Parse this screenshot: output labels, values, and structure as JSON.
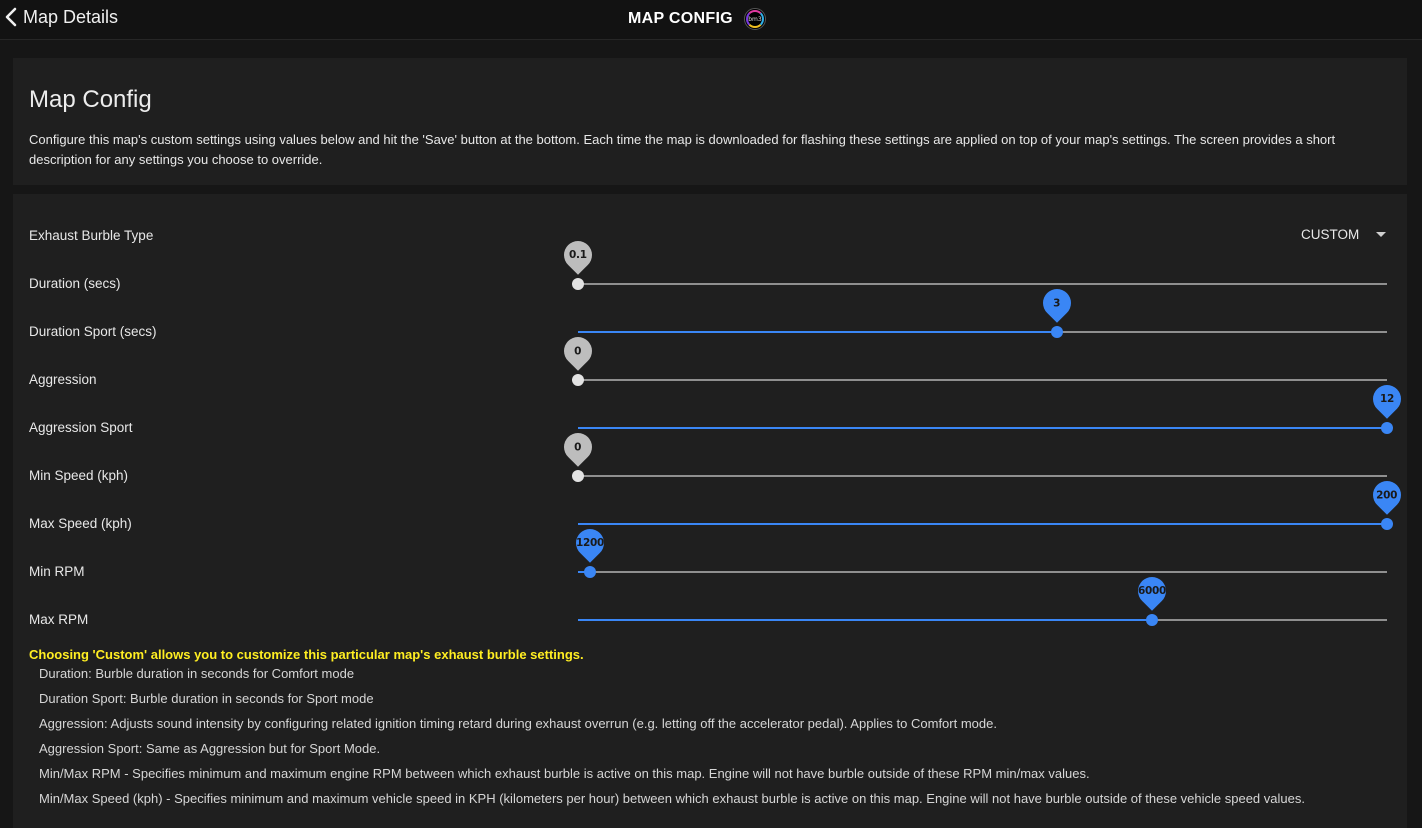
{
  "topbar": {
    "back_label": "Map Details",
    "title": "MAP CONFIG",
    "logo_text": "bm3"
  },
  "intro": {
    "heading": "Map Config",
    "description": "Configure this map's custom settings using values below and hit the 'Save' button at the bottom. Each time the map is downloaded for flashing these settings are applied on top of your map's settings. The screen provides a short description for any settings you choose to override."
  },
  "settings": {
    "burble_type_label": "Exhaust Burble Type",
    "burble_type_value": "CUSTOM",
    "sliders": [
      {
        "label": "Duration (secs)",
        "value": "0.1",
        "fraction": 0.0,
        "active": false
      },
      {
        "label": "Duration Sport (secs)",
        "value": "3",
        "fraction": 0.592,
        "active": true
      },
      {
        "label": "Aggression",
        "value": "0",
        "fraction": 0.0,
        "active": false
      },
      {
        "label": "Aggression Sport",
        "value": "12",
        "fraction": 1.0,
        "active": true
      },
      {
        "label": "Min Speed (kph)",
        "value": "0",
        "fraction": 0.0,
        "active": false
      },
      {
        "label": "Max Speed (kph)",
        "value": "200",
        "fraction": 1.0,
        "active": true
      },
      {
        "label": "Min RPM",
        "value": "1200",
        "fraction": 0.015,
        "active": true
      },
      {
        "label": "Max RPM",
        "value": "6000",
        "fraction": 0.709,
        "active": true
      }
    ],
    "note": "Choosing 'Custom' allows you to customize this particular map's exhaust burble settings.",
    "help": [
      "Duration: Burble duration in seconds for Comfort mode",
      "Duration Sport: Burble duration in seconds for Sport mode",
      "Aggression: Adjusts sound intensity by configuring related ignition timing retard during exhaust overrun (e.g. letting off the accelerator pedal). Applies to Comfort mode.",
      "Aggression Sport: Same as Aggression but for Sport Mode.",
      "Min/Max RPM - Specifies minimum and maximum engine RPM between which exhaust burble is active on this map. Engine will not have burble outside of these RPM min/max values.",
      "Min/Max Speed (kph) - Specifies minimum and maximum vehicle speed in KPH (kilometers per hour) between which exhaust burble is active on this map. Engine will not have burble outside of these vehicle speed values."
    ]
  },
  "colors": {
    "accent": "#3a86f5",
    "note": "#ffee22",
    "background": "#161616",
    "panel": "#1f1f1f"
  }
}
